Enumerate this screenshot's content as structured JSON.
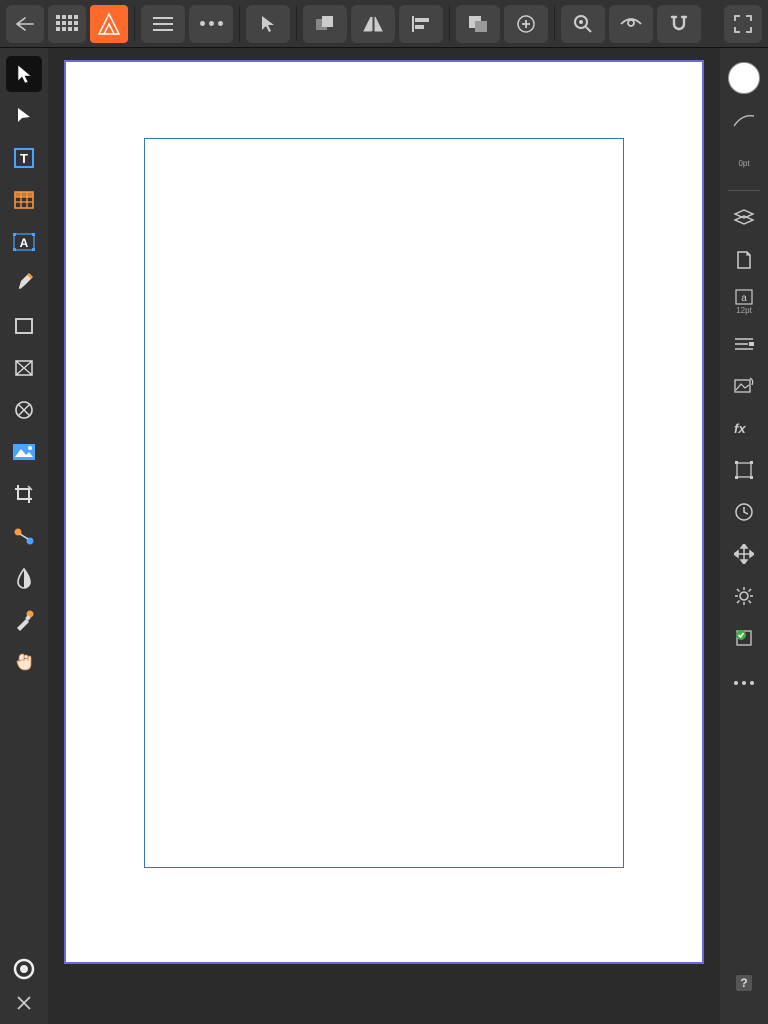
{
  "topbar": {
    "back": "back-icon",
    "grid": "grid-icon",
    "brand": "affinity-publisher-logo",
    "menu": "menu-icon",
    "more": "more-icon",
    "context_tools": [
      "move-tool-context",
      "arrange-icon",
      "flip-horizontal-icon",
      "align-icon",
      "group-icon",
      "insert-target-icon",
      "zoom-icon",
      "preview-icon",
      "snap-icon",
      "fullscreen-icon"
    ]
  },
  "left_tools": [
    {
      "name": "move-tool",
      "selected": true
    },
    {
      "name": "node-tool"
    },
    {
      "name": "frame-text-tool"
    },
    {
      "name": "table-tool"
    },
    {
      "name": "artistic-text-tool"
    },
    {
      "name": "pen-tool"
    },
    {
      "name": "rectangle-tool"
    },
    {
      "name": "picture-frame-rectangle-tool"
    },
    {
      "name": "picture-frame-ellipse-tool"
    },
    {
      "name": "place-image-tool"
    },
    {
      "name": "vector-crop-tool"
    },
    {
      "name": "fill-tool"
    },
    {
      "name": "transparency-tool"
    },
    {
      "name": "color-picker-tool"
    },
    {
      "name": "view-tool"
    }
  ],
  "left_bottom": {
    "toggle": "quick-ring-icon",
    "close": "close-icon"
  },
  "right_panels": {
    "color_swatch": "#ffffff",
    "stroke_label": "0pt",
    "items": [
      {
        "name": "brush-panel"
      },
      {
        "name": "stroke-panel",
        "label": "0pt"
      },
      {
        "name": "layers-panel"
      },
      {
        "name": "pages-panel"
      },
      {
        "name": "character-panel",
        "label": "12pt"
      },
      {
        "name": "paragraph-panel"
      },
      {
        "name": "stock-panel"
      },
      {
        "name": "fx-panel"
      },
      {
        "name": "transform-panel"
      },
      {
        "name": "history-panel"
      },
      {
        "name": "navigator-panel"
      },
      {
        "name": "preferences-panel"
      },
      {
        "name": "preflight-panel",
        "highlight": true
      }
    ],
    "more": "more-icon",
    "help": "help-icon"
  },
  "document": {
    "artboard_selected": true,
    "textframe_present": true
  }
}
